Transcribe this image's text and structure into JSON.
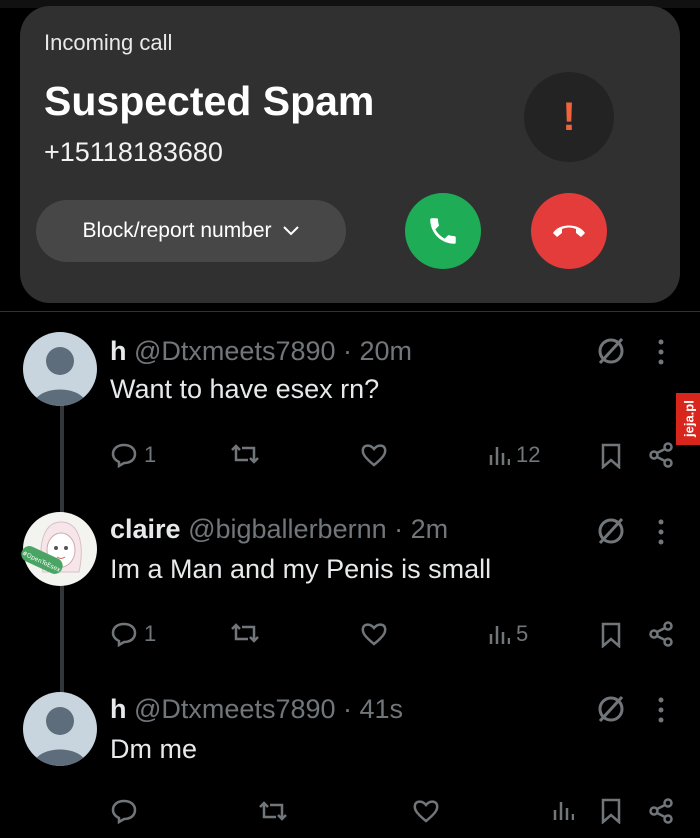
{
  "call": {
    "label": "Incoming call",
    "title": "Suspected Spam",
    "number": "+15118183680",
    "warning_symbol": "!",
    "block_label": "Block/report number"
  },
  "tweets": [
    {
      "name": "h",
      "handle": "@Dtxmeets7890",
      "time": "20m",
      "text": "Want to have esex rn?",
      "replies": "1",
      "views": "12"
    },
    {
      "name": "claire",
      "handle": "@bigballerbernn",
      "time": "2m",
      "text": "Im a Man and my Penis is small",
      "replies": "1",
      "views": "5",
      "avatar_badge": "#OpenToEsex"
    },
    {
      "name": "h",
      "handle": "@Dtxmeets7890",
      "time": "41s",
      "text": "Dm me",
      "replies": "",
      "views": ""
    }
  ],
  "watermark": "jeja.pl",
  "colors": {
    "accept": "#1eac56",
    "decline": "#e43b3b",
    "warning": "#f0643c"
  }
}
